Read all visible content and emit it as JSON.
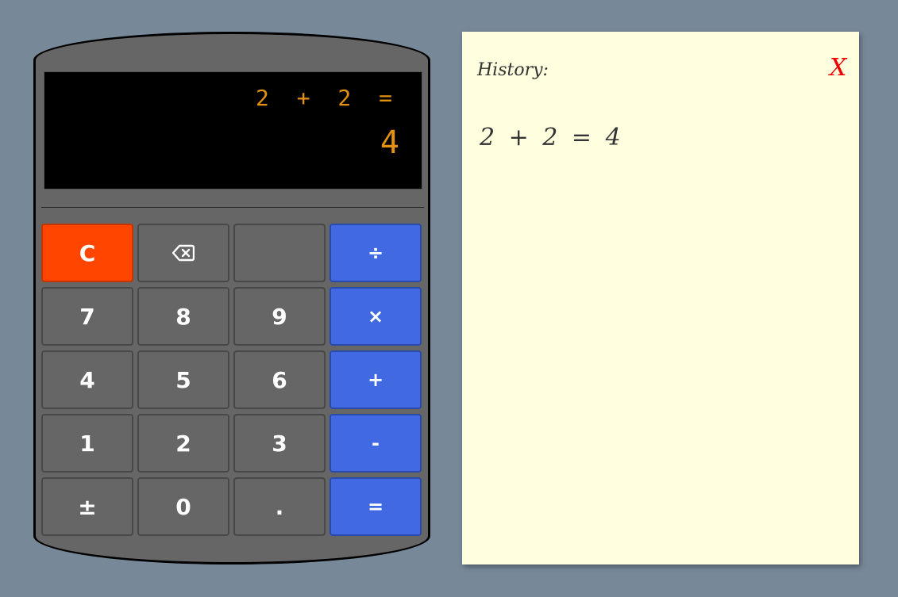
{
  "calculator": {
    "display": {
      "expression": "2 + 2 =",
      "result": "4",
      "color": "#e39211"
    },
    "keys": [
      {
        "label": "C",
        "name": "clear-button",
        "kind": "clear"
      },
      {
        "label": "",
        "name": "backspace-button",
        "kind": "normal",
        "icon": "backspace-icon"
      },
      {
        "label": "",
        "name": "blank-button",
        "kind": "normal"
      },
      {
        "label": "÷",
        "name": "divide-button",
        "kind": "op"
      },
      {
        "label": "7",
        "name": "digit-7-button",
        "kind": "normal"
      },
      {
        "label": "8",
        "name": "digit-8-button",
        "kind": "normal"
      },
      {
        "label": "9",
        "name": "digit-9-button",
        "kind": "normal"
      },
      {
        "label": "×",
        "name": "multiply-button",
        "kind": "op"
      },
      {
        "label": "4",
        "name": "digit-4-button",
        "kind": "normal"
      },
      {
        "label": "5",
        "name": "digit-5-button",
        "kind": "normal"
      },
      {
        "label": "6",
        "name": "digit-6-button",
        "kind": "normal"
      },
      {
        "label": "+",
        "name": "add-button",
        "kind": "op"
      },
      {
        "label": "1",
        "name": "digit-1-button",
        "kind": "normal"
      },
      {
        "label": "2",
        "name": "digit-2-button",
        "kind": "normal"
      },
      {
        "label": "3",
        "name": "digit-3-button",
        "kind": "normal"
      },
      {
        "label": "-",
        "name": "subtract-button",
        "kind": "op"
      },
      {
        "label": "±",
        "name": "negate-button",
        "kind": "normal"
      },
      {
        "label": "0",
        "name": "digit-0-button",
        "kind": "normal"
      },
      {
        "label": ".",
        "name": "decimal-button",
        "kind": "normal"
      },
      {
        "label": "=",
        "name": "equals-button",
        "kind": "op"
      }
    ],
    "colors": {
      "body": "#666666",
      "clear": "#ff4500",
      "operator": "#4169e1"
    }
  },
  "history": {
    "title": "History:",
    "close_label": "X",
    "entries": [
      "2 + 2 = 4"
    ],
    "colors": {
      "paper": "#ffffe0",
      "close": "#ee0000"
    }
  },
  "background_color": "#778899"
}
